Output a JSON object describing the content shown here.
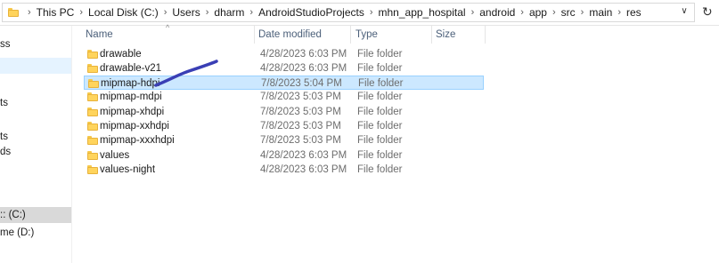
{
  "address": {
    "crumbs": [
      "This PC",
      "Local Disk (C:)",
      "Users",
      "dharm",
      "AndroidStudioProjects",
      "mhn_app_hospital",
      "android",
      "app",
      "src",
      "main",
      "res"
    ],
    "separator": "›",
    "dropdown_glyph": "∨",
    "refresh_glyph": "↻"
  },
  "sidebar": {
    "items": [
      {
        "label": "ss"
      },
      {
        "label": ""
      },
      {
        "label": "ts"
      },
      {
        "label": "ts"
      },
      {
        "label": "ds"
      },
      {
        "label": ":: (C:)"
      },
      {
        "label": "me (D:)"
      }
    ]
  },
  "columns": {
    "name": "Name",
    "date": "Date modified",
    "type": "Type",
    "size": "Size",
    "sort_glyph": "^"
  },
  "files": [
    {
      "name": "drawable",
      "date": "4/28/2023 6:03 PM",
      "type": "File folder"
    },
    {
      "name": "drawable-v21",
      "date": "4/28/2023 6:03 PM",
      "type": "File folder"
    },
    {
      "name": "mipmap-hdpi",
      "date": "7/8/2023 5:04 PM",
      "type": "File folder"
    },
    {
      "name": "mipmap-mdpi",
      "date": "7/8/2023 5:03 PM",
      "type": "File folder"
    },
    {
      "name": "mipmap-xhdpi",
      "date": "7/8/2023 5:03 PM",
      "type": "File folder"
    },
    {
      "name": "mipmap-xxhdpi",
      "date": "7/8/2023 5:03 PM",
      "type": "File folder"
    },
    {
      "name": "mipmap-xxxhdpi",
      "date": "7/8/2023 5:03 PM",
      "type": "File folder"
    },
    {
      "name": "values",
      "date": "4/28/2023 6:03 PM",
      "type": "File folder"
    },
    {
      "name": "values-night",
      "date": "4/28/2023 6:03 PM",
      "type": "File folder"
    }
  ],
  "selected_row": "mipmap-hdpi",
  "colors": {
    "selection_fill": "#cce8ff",
    "selection_border": "#99d1ff",
    "folder": "#ffd45c",
    "annotation_stroke": "#3a3fb5"
  }
}
